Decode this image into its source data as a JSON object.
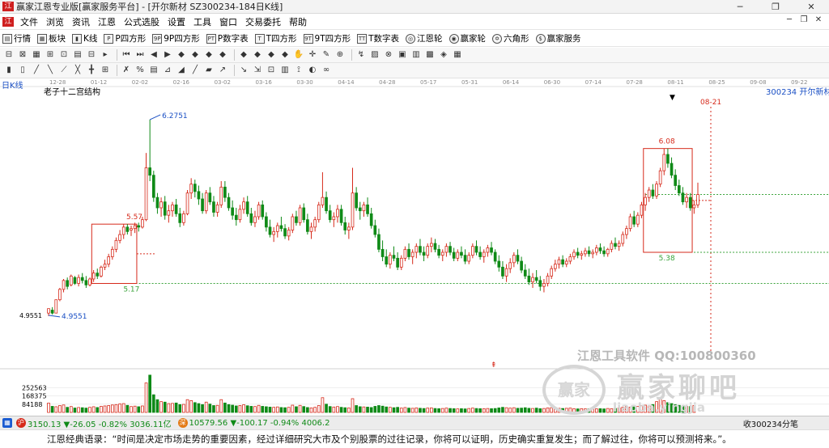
{
  "window": {
    "title": "赢家江恩专业版[赢家服务平台] - [开尔新材  SZ300234-184日K线]",
    "logo": "江",
    "buttons": [
      "─",
      "❐",
      "✕"
    ]
  },
  "menu": {
    "logo": "江",
    "items": [
      "文件",
      "浏览",
      "资讯",
      "江恩",
      "公式选股",
      "设置",
      "工具",
      "窗口",
      "交易委托",
      "帮助"
    ],
    "mdi": [
      "─",
      "❐",
      "✕"
    ]
  },
  "nav": {
    "items": [
      {
        "icon": "▤",
        "label": "行情"
      },
      {
        "icon": "▦",
        "label": "板块"
      },
      {
        "icon": "▮",
        "label": "K线"
      },
      {
        "icon": "P",
        "label": "P四方形"
      },
      {
        "icon": "9P",
        "label": "9P四方形"
      },
      {
        "icon": "PT",
        "label": "P数字表"
      },
      {
        "icon": "T",
        "label": "T四方形"
      },
      {
        "icon": "9T",
        "label": "9T四方形"
      },
      {
        "icon": "TT",
        "label": "T数字表"
      },
      {
        "icon": "◎",
        "label": "江恩轮",
        "round": true
      },
      {
        "icon": "◉",
        "label": "赢家轮",
        "round": true
      },
      {
        "icon": "✡",
        "label": "六角形",
        "round": true
      },
      {
        "icon": "$",
        "label": "赢家服务",
        "round": true
      }
    ]
  },
  "toolbar1": [
    "⊟",
    "⊠",
    "▦",
    "⊞",
    "⊡",
    "▤",
    "⊟",
    "▸",
    "⏮",
    "⏭",
    "◀",
    "▶",
    "◆",
    "◆",
    "◆",
    "◆",
    "◆",
    "◆",
    "◆",
    "◆",
    "✋",
    "✛",
    "✎",
    "⊕",
    "↯",
    "▨",
    "⊗",
    "▣",
    "▥",
    "▩",
    "◈",
    "▦"
  ],
  "toolbar2": [
    "▮",
    "▯",
    "╱",
    "╲",
    "⟋",
    "╳",
    "╋",
    "⊞",
    "✗",
    "%",
    "▤",
    "⊿",
    "◢",
    "╱",
    "▰",
    "↗",
    "↘",
    "⇲",
    "⊡",
    "▥",
    "⟟",
    "◐",
    "∞"
  ],
  "chart_header": {
    "period_label": "日K线",
    "structure_label": "老子十二宫结构",
    "stock_label": "300234  开尔新材",
    "future_date": "08-21",
    "date_ticks": [
      "12-28",
      "01-12",
      "02-02",
      "02-16",
      "03-02",
      "03-16",
      "03-30",
      "04-14",
      "04-28",
      "05-17",
      "05-31",
      "06-14",
      "06-30",
      "07-14",
      "07-28",
      "08-11",
      "08-25",
      "09-08",
      "09-22"
    ]
  },
  "chart_data": {
    "type": "candlestick",
    "title": "300234 开尔新材 日K线",
    "ylim": [
      4.6,
      6.4
    ],
    "price_labels": [
      {
        "text": "6.2751",
        "value": 6.2751
      },
      {
        "text": "5.57",
        "value": 5.57
      },
      {
        "text": "5.17",
        "value": 5.17
      },
      {
        "text": "4.9551",
        "value": 4.9551
      },
      {
        "text": "6.08",
        "value": 6.08
      },
      {
        "text": "5.38",
        "value": 5.38
      }
    ],
    "y_axis_label": "4.9551",
    "boxes": [
      {
        "from_index": 12,
        "to_index": 23,
        "low": 5.17,
        "high": 5.57
      },
      {
        "from_index": 159,
        "to_index": 171,
        "low": 5.38,
        "high": 6.08
      }
    ],
    "level_lines": [
      5.17,
      5.38,
      5.77
    ],
    "volume_axis": [
      "252563",
      "168375",
      "84188"
    ],
    "volume_ylim": [
      0,
      420000
    ],
    "candles": [
      [
        4.97,
        5.0,
        4.95,
        5.0
      ],
      [
        4.99,
        5.01,
        4.96,
        4.97
      ],
      [
        4.97,
        5.06,
        4.97,
        5.06
      ],
      [
        5.06,
        5.14,
        5.05,
        5.13
      ],
      [
        5.13,
        5.2,
        5.11,
        5.19
      ],
      [
        5.19,
        5.21,
        5.13,
        5.15
      ],
      [
        5.16,
        5.23,
        5.15,
        5.22
      ],
      [
        5.21,
        5.22,
        5.16,
        5.17
      ],
      [
        5.17,
        5.23,
        5.15,
        5.21
      ],
      [
        5.21,
        5.24,
        5.17,
        5.19
      ],
      [
        5.19,
        5.22,
        5.14,
        5.16
      ],
      [
        5.16,
        5.21,
        5.15,
        5.2
      ],
      [
        5.2,
        5.26,
        5.18,
        5.24
      ],
      [
        5.24,
        5.27,
        5.2,
        5.22
      ],
      [
        5.22,
        5.29,
        5.21,
        5.28
      ],
      [
        5.28,
        5.33,
        5.26,
        5.3
      ],
      [
        5.3,
        5.37,
        5.28,
        5.35
      ],
      [
        5.35,
        5.42,
        5.33,
        5.4
      ],
      [
        5.4,
        5.48,
        5.38,
        5.46
      ],
      [
        5.46,
        5.53,
        5.44,
        5.5
      ],
      [
        5.5,
        5.57,
        5.47,
        5.55
      ],
      [
        5.55,
        5.57,
        5.5,
        5.52
      ],
      [
        5.53,
        5.56,
        5.49,
        5.54
      ],
      [
        5.54,
        5.58,
        5.51,
        5.56
      ],
      [
        5.56,
        5.58,
        5.52,
        5.55
      ],
      [
        5.55,
        5.62,
        5.54,
        5.6
      ],
      [
        5.6,
        6.05,
        5.59,
        5.95
      ],
      [
        5.95,
        6.2751,
        5.86,
        5.9
      ],
      [
        5.9,
        5.93,
        5.72,
        5.75
      ],
      [
        5.75,
        5.78,
        5.64,
        5.68
      ],
      [
        5.68,
        5.75,
        5.62,
        5.72
      ],
      [
        5.72,
        5.76,
        5.6,
        5.63
      ],
      [
        5.63,
        5.7,
        5.58,
        5.66
      ],
      [
        5.66,
        5.72,
        5.62,
        5.7
      ],
      [
        5.7,
        5.74,
        5.62,
        5.64
      ],
      [
        5.64,
        5.68,
        5.55,
        5.58
      ],
      [
        5.58,
        5.66,
        5.56,
        5.64
      ],
      [
        5.64,
        5.8,
        5.63,
        5.78
      ],
      [
        5.78,
        5.88,
        5.74,
        5.84
      ],
      [
        5.84,
        5.87,
        5.75,
        5.79
      ],
      [
        5.79,
        5.83,
        5.7,
        5.74
      ],
      [
        5.74,
        5.78,
        5.64,
        5.66
      ],
      [
        5.66,
        5.8,
        5.64,
        5.78
      ],
      [
        5.78,
        5.82,
        5.7,
        5.72
      ],
      [
        5.72,
        5.76,
        5.62,
        5.65
      ],
      [
        5.65,
        5.72,
        5.62,
        5.7
      ],
      [
        5.7,
        5.86,
        5.68,
        5.82
      ],
      [
        5.82,
        5.86,
        5.72,
        5.75
      ],
      [
        5.75,
        5.78,
        5.66,
        5.68
      ],
      [
        5.68,
        5.73,
        5.6,
        5.63
      ],
      [
        5.63,
        5.68,
        5.56,
        5.6
      ],
      [
        5.6,
        5.7,
        5.58,
        5.67
      ],
      [
        5.67,
        5.75,
        5.64,
        5.72
      ],
      [
        5.72,
        5.76,
        5.62,
        5.64
      ],
      [
        5.64,
        5.68,
        5.56,
        5.58
      ],
      [
        5.58,
        5.66,
        5.55,
        5.62
      ],
      [
        5.62,
        5.72,
        5.6,
        5.7
      ],
      [
        5.7,
        5.73,
        5.6,
        5.62
      ],
      [
        5.62,
        5.65,
        5.52,
        5.55
      ],
      [
        5.55,
        5.6,
        5.48,
        5.5
      ],
      [
        5.5,
        5.55,
        5.45,
        5.52
      ],
      [
        5.52,
        5.58,
        5.48,
        5.56
      ],
      [
        5.56,
        5.62,
        5.52,
        5.54
      ],
      [
        5.54,
        5.57,
        5.47,
        5.49
      ],
      [
        5.49,
        5.55,
        5.46,
        5.53
      ],
      [
        5.53,
        5.64,
        5.51,
        5.62
      ],
      [
        5.62,
        5.66,
        5.56,
        5.58
      ],
      [
        5.58,
        5.7,
        5.56,
        5.68
      ],
      [
        5.68,
        5.71,
        5.58,
        5.6
      ],
      [
        5.6,
        5.64,
        5.5,
        5.52
      ],
      [
        5.52,
        5.58,
        5.47,
        5.55
      ],
      [
        5.55,
        5.62,
        5.52,
        5.6
      ],
      [
        5.6,
        5.72,
        5.58,
        5.7
      ],
      [
        5.7,
        5.92,
        5.68,
        5.75
      ],
      [
        5.75,
        5.79,
        5.64,
        5.66
      ],
      [
        5.66,
        5.7,
        5.58,
        5.6
      ],
      [
        5.6,
        5.65,
        5.55,
        5.62
      ],
      [
        5.62,
        5.7,
        5.58,
        5.67
      ],
      [
        5.67,
        5.7,
        5.56,
        5.58
      ],
      [
        5.58,
        5.62,
        5.5,
        5.53
      ],
      [
        5.53,
        5.58,
        5.47,
        5.55
      ],
      [
        5.55,
        5.95,
        5.53,
        5.78
      ],
      [
        5.78,
        5.82,
        5.66,
        5.68
      ],
      [
        5.68,
        5.72,
        5.6,
        5.66
      ],
      [
        5.66,
        5.72,
        5.62,
        5.7
      ],
      [
        5.7,
        5.75,
        5.62,
        5.64
      ],
      [
        5.64,
        5.68,
        5.54,
        5.56
      ],
      [
        5.56,
        5.6,
        5.48,
        5.5
      ],
      [
        5.5,
        5.54,
        5.38,
        5.4
      ],
      [
        5.4,
        5.46,
        5.32,
        5.35
      ],
      [
        5.35,
        5.4,
        5.28,
        5.3
      ],
      [
        5.3,
        5.38,
        5.27,
        5.36
      ],
      [
        5.36,
        5.42,
        5.32,
        5.34
      ],
      [
        5.34,
        5.38,
        5.26,
        5.28
      ],
      [
        5.28,
        5.36,
        5.26,
        5.34
      ],
      [
        5.34,
        5.42,
        5.32,
        5.4
      ],
      [
        5.4,
        5.44,
        5.33,
        5.35
      ],
      [
        5.35,
        5.4,
        5.3,
        5.38
      ],
      [
        5.38,
        5.44,
        5.34,
        5.42
      ],
      [
        5.42,
        5.47,
        5.36,
        5.38
      ],
      [
        5.38,
        5.42,
        5.32,
        5.36
      ],
      [
        5.36,
        5.44,
        5.34,
        5.42
      ],
      [
        5.42,
        5.48,
        5.38,
        5.44
      ],
      [
        5.44,
        5.47,
        5.38,
        5.4
      ],
      [
        5.4,
        5.43,
        5.34,
        5.36
      ],
      [
        5.36,
        5.4,
        5.32,
        5.38
      ],
      [
        5.38,
        5.44,
        5.35,
        5.42
      ],
      [
        5.42,
        5.45,
        5.36,
        5.38
      ],
      [
        5.38,
        5.41,
        5.32,
        5.34
      ],
      [
        5.34,
        5.4,
        5.32,
        5.38
      ],
      [
        5.38,
        5.42,
        5.34,
        5.36
      ],
      [
        5.36,
        5.4,
        5.3,
        5.32
      ],
      [
        5.32,
        5.38,
        5.3,
        5.36
      ],
      [
        5.36,
        5.44,
        5.34,
        5.42
      ],
      [
        5.42,
        5.46,
        5.36,
        5.38
      ],
      [
        5.38,
        5.42,
        5.33,
        5.35
      ],
      [
        5.35,
        5.4,
        5.31,
        5.38
      ],
      [
        5.38,
        5.43,
        5.35,
        5.41
      ],
      [
        5.41,
        5.45,
        5.36,
        5.38
      ],
      [
        5.38,
        5.4,
        5.3,
        5.32
      ],
      [
        5.32,
        5.36,
        5.25,
        5.28
      ],
      [
        5.28,
        5.32,
        5.2,
        5.22
      ],
      [
        5.22,
        5.3,
        5.18,
        5.27
      ],
      [
        5.27,
        5.34,
        5.24,
        5.31
      ],
      [
        5.31,
        5.38,
        5.28,
        5.36
      ],
      [
        5.36,
        5.4,
        5.3,
        5.32
      ],
      [
        5.32,
        5.35,
        5.24,
        5.26
      ],
      [
        5.26,
        5.3,
        5.2,
        5.22
      ],
      [
        5.22,
        5.27,
        5.16,
        5.18
      ],
      [
        5.18,
        5.24,
        5.14,
        5.21
      ],
      [
        5.21,
        5.26,
        5.17,
        5.19
      ],
      [
        5.19,
        5.22,
        5.12,
        5.15
      ],
      [
        5.15,
        5.2,
        5.11,
        5.17
      ],
      [
        5.17,
        5.24,
        5.15,
        5.22
      ],
      [
        5.22,
        5.29,
        5.2,
        5.27
      ],
      [
        5.27,
        5.33,
        5.25,
        5.3
      ],
      [
        5.3,
        5.35,
        5.27,
        5.33
      ],
      [
        5.33,
        5.36,
        5.28,
        5.3
      ],
      [
        5.3,
        5.34,
        5.28,
        5.32
      ],
      [
        5.32,
        5.37,
        5.3,
        5.35
      ],
      [
        5.35,
        5.4,
        5.33,
        5.38
      ],
      [
        5.38,
        5.41,
        5.34,
        5.36
      ],
      [
        5.36,
        5.39,
        5.33,
        5.37
      ],
      [
        5.37,
        5.41,
        5.35,
        5.39
      ],
      [
        5.39,
        5.42,
        5.35,
        5.37
      ],
      [
        5.37,
        5.4,
        5.34,
        5.38
      ],
      [
        5.38,
        5.43,
        5.36,
        5.41
      ],
      [
        5.41,
        5.44,
        5.37,
        5.39
      ],
      [
        5.39,
        5.42,
        5.35,
        5.37
      ],
      [
        5.37,
        5.41,
        5.35,
        5.4
      ],
      [
        5.4,
        5.46,
        5.38,
        5.44
      ],
      [
        5.44,
        5.48,
        5.4,
        5.42
      ],
      [
        5.42,
        5.46,
        5.39,
        5.44
      ],
      [
        5.44,
        5.52,
        5.42,
        5.5
      ],
      [
        5.5,
        5.56,
        5.47,
        5.54
      ],
      [
        5.54,
        5.64,
        5.52,
        5.62
      ],
      [
        5.62,
        5.66,
        5.55,
        5.57
      ],
      [
        5.57,
        5.65,
        5.55,
        5.63
      ],
      [
        5.63,
        5.72,
        5.61,
        5.7
      ],
      [
        5.7,
        5.78,
        5.66,
        5.75
      ],
      [
        5.75,
        5.82,
        5.72,
        5.8
      ],
      [
        5.8,
        5.84,
        5.74,
        5.76
      ],
      [
        5.76,
        5.86,
        5.74,
        5.84
      ],
      [
        5.84,
        5.95,
        5.82,
        5.93
      ],
      [
        5.93,
        6.08,
        5.9,
        6.04
      ],
      [
        6.04,
        6.08,
        5.95,
        5.98
      ],
      [
        5.98,
        6.02,
        5.88,
        5.9
      ],
      [
        5.9,
        5.94,
        5.8,
        5.83
      ],
      [
        5.83,
        5.87,
        5.76,
        5.78
      ],
      [
        5.78,
        5.82,
        5.7,
        5.72
      ],
      [
        5.72,
        5.78,
        5.68,
        5.75
      ],
      [
        5.75,
        5.78,
        5.66,
        5.68
      ],
      [
        5.68,
        5.73,
        5.64,
        5.7
      ],
      [
        5.7,
        5.85,
        5.68,
        5.77
      ]
    ],
    "volumes": [
      95000,
      62000,
      58000,
      70000,
      76000,
      52000,
      60000,
      45000,
      50000,
      48000,
      44000,
      52000,
      58000,
      50000,
      62000,
      66000,
      70000,
      76000,
      80000,
      86000,
      90000,
      72000,
      60000,
      64000,
      58000,
      66000,
      300000,
      380000,
      180000,
      130000,
      110000,
      105000,
      90000,
      92000,
      96000,
      80000,
      82000,
      130000,
      120000,
      100000,
      90000,
      80000,
      105000,
      85000,
      70000,
      72000,
      130000,
      96000,
      80000,
      74000,
      66000,
      70000,
      78000,
      68000,
      62000,
      60000,
      72000,
      62000,
      58000,
      54000,
      52000,
      56000,
      50000,
      48000,
      52000,
      74000,
      58000,
      72000,
      60000,
      50000,
      46000,
      52000,
      70000,
      150000,
      84000,
      60000,
      55000,
      60000,
      52000,
      48000,
      46000,
      140000,
      70000,
      58000,
      56000,
      54000,
      50000,
      62000,
      70000,
      64000,
      56000,
      52000,
      48000,
      52000,
      44000,
      50000,
      44000,
      42000,
      46000,
      42000,
      40000,
      44000,
      46000,
      40000,
      38000,
      40000,
      44000,
      40000,
      38000,
      36000,
      38000,
      36000,
      40000,
      44000,
      40000,
      38000,
      38000,
      40000,
      38000,
      40000,
      46000,
      52000,
      48000,
      44000,
      48000,
      42000,
      44000,
      48000,
      42000,
      40000,
      44000,
      38000,
      40000,
      46000,
      48000,
      44000,
      42000,
      40000,
      42000,
      44000,
      38000,
      36000,
      38000,
      36000,
      38000,
      40000,
      36000,
      38000,
      36000,
      40000,
      38000,
      40000,
      46000,
      52000,
      58000,
      54000,
      56000,
      62000,
      70000,
      74000,
      66000,
      80000,
      110000,
      140000,
      120000,
      100000,
      90000,
      80000,
      72000,
      66000,
      62000,
      60000,
      70000
    ]
  },
  "status": {
    "sh_icon": "沪",
    "sh_quote": "3150.13 ▼-26.05 -0.82% 3036.11亿",
    "sz_icon": "深",
    "sz_quote": "10579.56 ▼-100.17 -0.94% 4006.2",
    "right_text": "收300234分笔"
  },
  "watermark": {
    "line1": "江恩工具软件  QQ:100800360",
    "line2": "赢家聊吧",
    "line3": "liaoba.yingjia",
    "logo": "赢家"
  },
  "quote": {
    "text": "江恩经典语录：“时间是决定市场走势的重要因素，经过详细研究大市及个别股票的过往记录，你将可以证明，历史确实重复发生；而了解过往，你将可以预测将来。”。"
  },
  "colors": {
    "up": "#d62a1b",
    "down": "#0f8a17",
    "box": "#d62a1b",
    "level": "#3aa33a"
  }
}
